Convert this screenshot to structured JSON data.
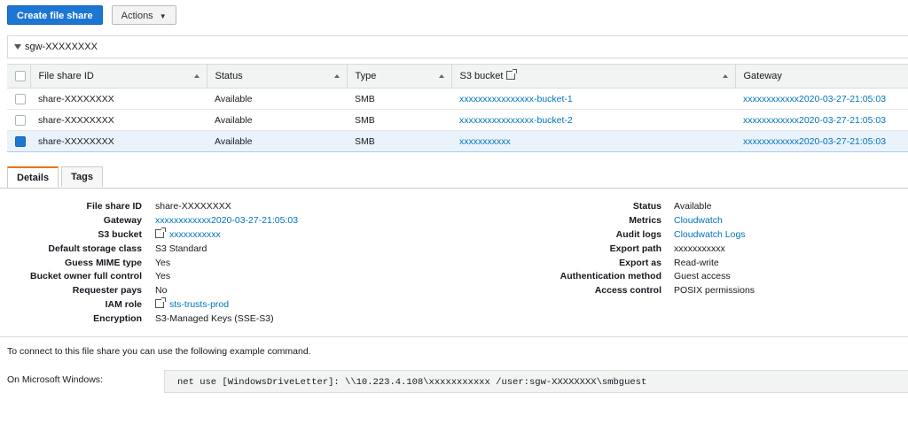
{
  "toolbar": {
    "create_label": "Create file share",
    "actions_label": "Actions"
  },
  "filter": {
    "value": "sgw-XXXXXXXX"
  },
  "table": {
    "columns": [
      "File share ID",
      "Status",
      "Type",
      "S3 bucket",
      "Gateway"
    ],
    "rows": [
      {
        "id": "share-XXXXXXXX",
        "status": "Available",
        "type": "SMB",
        "bucket": "xxxxxxxxxxxxxxxx-bucket-1",
        "gateway": "xxxxxxxxxxxx2020-03-27-21:05:03",
        "selected": false
      },
      {
        "id": "share-XXXXXXXX",
        "status": "Available",
        "type": "SMB",
        "bucket": "xxxxxxxxxxxxxxxx-bucket-2",
        "gateway": "xxxxxxxxxxxx2020-03-27-21:05:03",
        "selected": false
      },
      {
        "id": "share-XXXXXXXX",
        "status": "Available",
        "type": "SMB",
        "bucket": "xxxxxxxxxxx",
        "gateway": "xxxxxxxxxxxx2020-03-27-21:05:03",
        "selected": true
      }
    ]
  },
  "tabs": [
    "Details",
    "Tags"
  ],
  "details": {
    "left": [
      {
        "key": "File share ID",
        "value": "share-XXXXXXXX"
      },
      {
        "key": "Gateway",
        "value": "xxxxxxxxxxxx2020-03-27-21:05:03"
      },
      {
        "key": "S3 bucket",
        "value": "xxxxxxxxxxx"
      },
      {
        "key": "Default storage class",
        "value": "S3 Standard"
      },
      {
        "key": "Guess MIME type",
        "value": "Yes"
      },
      {
        "key": "Bucket owner full control",
        "value": "Yes"
      },
      {
        "key": "Requester pays",
        "value": "No"
      },
      {
        "key": "IAM role",
        "value": "sts-trusts-prod"
      },
      {
        "key": "Encryption",
        "value": "S3-Managed Keys (SSE-S3)"
      }
    ],
    "right": [
      {
        "key": "Status",
        "value": "Available"
      },
      {
        "key": "Metrics",
        "value": "Cloudwatch"
      },
      {
        "key": "Audit logs",
        "value": "Cloudwatch Logs"
      },
      {
        "key": "Export path",
        "value": "xxxxxxxxxxx"
      },
      {
        "key": "Export as",
        "value": "Read-write"
      },
      {
        "key": "Authentication method",
        "value": "Guest access"
      },
      {
        "key": "Access control",
        "value": "POSIX permissions"
      }
    ]
  },
  "hint": "To connect to this file share you can use the following example command.",
  "windows_label": "On Microsoft Windows:",
  "command": "net use [WindowsDriveLetter]: \\\\10.223.4.108\\xxxxxxxxxxx /user:sgw-XXXXXXXX\\smbguest",
  "colors": {
    "primary": "#1e76d4",
    "link": "#0073bb",
    "tab_accent": "#ec7211",
    "selected_row": "#eaf3fb"
  }
}
